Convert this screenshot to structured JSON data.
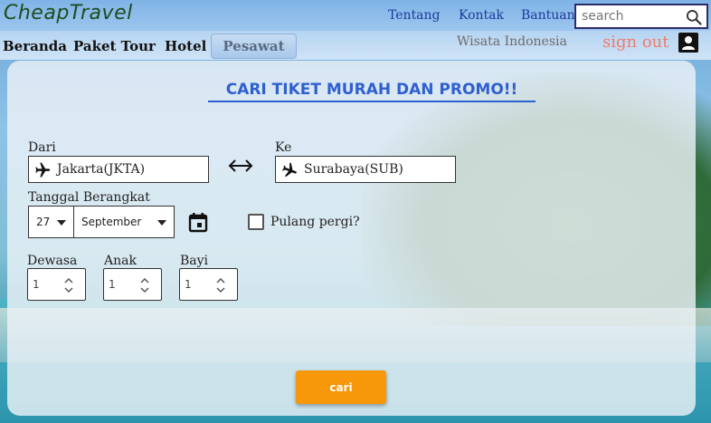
{
  "header": {
    "logo": "CheapTravel",
    "links": [
      "Tentang",
      "Kontak",
      "Bantuan"
    ],
    "search_placeholder": "search"
  },
  "nav": {
    "items": [
      "Beranda",
      "Paket Tour",
      "Hotel",
      "Pesawat"
    ],
    "active": "Pesawat",
    "wisata": "Wisata Indonesia",
    "signout": "sign out"
  },
  "form": {
    "heading": "CARI TIKET MURAH DAN PROMO!!",
    "from_label": "Dari",
    "from_value": "Jakarta(JKTA)",
    "to_label": "Ke",
    "to_value": "Surabaya(SUB)",
    "date_label": "Tanggal Berangkat",
    "day": "27",
    "month": "September",
    "roundtrip_label": "Pulang pergi?",
    "adult_label": "Dewasa",
    "adult_value": "1",
    "child_label": "Anak",
    "child_value": "1",
    "infant_label": "Bayi",
    "infant_value": "1",
    "submit": "cari"
  },
  "colors": {
    "accent": "#f7970a",
    "heading": "#2f5fd0",
    "signout": "#f27a6a"
  },
  "icons": [
    "search-icon",
    "user-icon",
    "plane-icon",
    "swap-arrows-icon",
    "calendar-icon",
    "chevron-down-icon",
    "spinner-icon"
  ]
}
